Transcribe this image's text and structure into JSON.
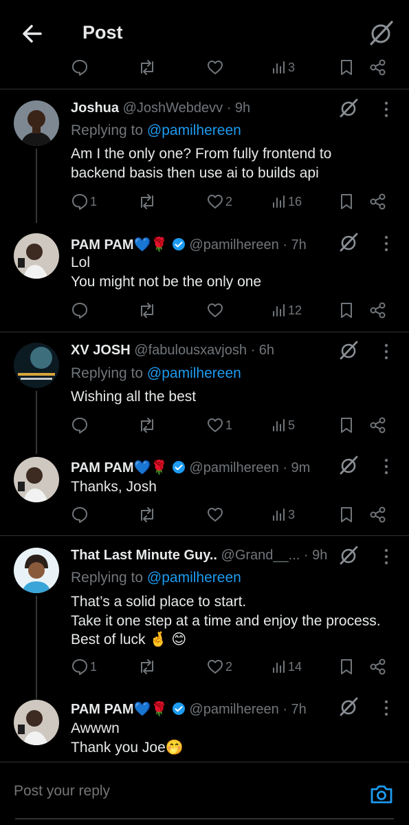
{
  "header": {
    "title": "Post"
  },
  "prev_actions": {
    "views": "3"
  },
  "tweets": [
    {
      "name": "Joshua",
      "handle": "@JoshWebdevv",
      "time": "· 9h",
      "replying_prefix": "Replying to",
      "replying_to": "@pamilhereen",
      "lines": [
        "Am I the only one? From fully frontend to",
        "backend basis then use ai to builds api"
      ],
      "replies": "1",
      "likes": "2",
      "views": "16"
    },
    {
      "name": "PAM PAM💙🌹",
      "handle": "@pamilhereen",
      "time": "· 7h",
      "lines": [
        "Lol",
        "You might not be the only one"
      ],
      "replies": "",
      "likes": "",
      "views": "12"
    },
    {
      "name": "XV JOSH",
      "handle": "@fabulousxavjosh",
      "time": "· 6h",
      "replying_prefix": "Replying to",
      "replying_to": "@pamilhereen",
      "lines": [
        "Wishing all the best"
      ],
      "replies": "",
      "likes": "1",
      "views": "5"
    },
    {
      "name": "PAM PAM💙🌹",
      "handle": "@pamilhereen",
      "time": "· 9m",
      "lines": [
        "Thanks,  Josh"
      ],
      "replies": "",
      "likes": "",
      "views": "3"
    },
    {
      "name": "That Last Minute Guy..",
      "handle": "@Grand__...",
      "time": "· 9h",
      "replying_prefix": "Replying to",
      "replying_to": "@pamilhereen",
      "lines": [
        "That’s a solid place to start.",
        "Take it one step at a time and enjoy the process.",
        "Best of luck 🤞 😊"
      ],
      "replies": "1",
      "likes": "2",
      "views": "14"
    },
    {
      "name": "PAM PAM💙🌹",
      "handle": "@pamilhereen",
      "time": "· 7h",
      "lines": [
        "Awwwn",
        "Thank you Joe🤭"
      ]
    }
  ],
  "composer": {
    "placeholder": "Post your reply"
  },
  "colors": {
    "accent": "#1d9bf0",
    "muted": "#71767b",
    "text": "#e7e9ea",
    "divider": "#2f3336",
    "background": "#000000"
  },
  "icons": [
    "back-arrow-icon",
    "grok-icon",
    "more-icon",
    "reply-icon",
    "repost-icon",
    "like-icon",
    "views-icon",
    "bookmark-icon",
    "share-icon",
    "verified-icon",
    "camera-icon"
  ]
}
